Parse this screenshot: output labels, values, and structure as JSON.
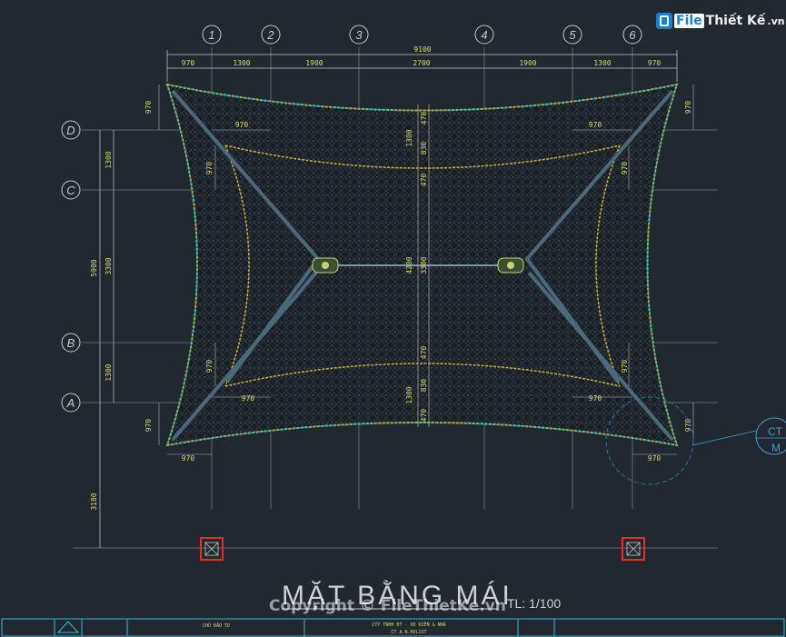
{
  "logo": {
    "text_file": "File",
    "text_rest": "Thiết Kế",
    "text_domain": ".vn"
  },
  "grid_top": [
    "1",
    "2",
    "3",
    "4",
    "5",
    "6"
  ],
  "grid_left": [
    "D",
    "C",
    "B",
    "A"
  ],
  "dims_top": {
    "total": "9100",
    "segments": [
      "970",
      "1300",
      "1900",
      "2700",
      "1900",
      "1300",
      "970"
    ]
  },
  "dims_side": {
    "left_outer": [
      "5900",
      "3180"
    ],
    "left_inner": [
      "1300",
      "3300",
      "1300"
    ],
    "corner": "970"
  },
  "dims_center": [
    "470",
    "1300",
    "830",
    "470",
    "4200",
    "3300",
    "470",
    "830",
    "1300",
    "470"
  ],
  "callout": {
    "code": "CT",
    "sub": "M"
  },
  "title": "MẶT BẰNG MÁI",
  "scale": "TL: 1/100",
  "watermark": "Copyright © FileThietKe.vn",
  "title_block": {
    "owner_label": "CHỦ ĐẦU TƯ",
    "company_line1": "CTY TNHH ĐT - XD KIẾN & NHÀ",
    "company_line2": "CT A.N.HOLIST"
  },
  "colors": {
    "background": "#212830",
    "membrane_edge": "#c8b040",
    "cable": "#28b8b8",
    "grid_line": "#8a8a8a",
    "marker_red": "#e03020",
    "titleblock_cyan": "#30c0d8"
  }
}
